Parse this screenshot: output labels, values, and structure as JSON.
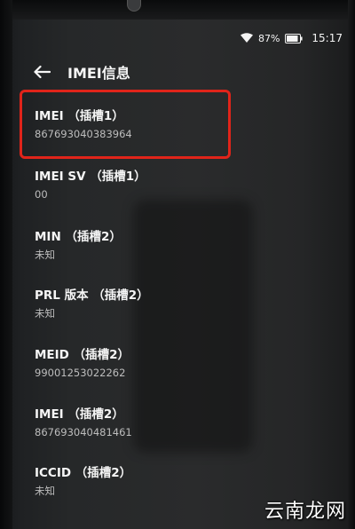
{
  "status_bar": {
    "battery_percent": "87%",
    "time": "15:17"
  },
  "app_bar": {
    "title": "IMEI信息"
  },
  "items": [
    {
      "title": "IMEI （插槽1）",
      "value": "867693040383964"
    },
    {
      "title": "IMEI SV （插槽1）",
      "value": "00"
    },
    {
      "title": "MIN （插槽2）",
      "value": "未知"
    },
    {
      "title": "PRL 版本 （插槽2）",
      "value": "未知"
    },
    {
      "title": "MEID （插槽2）",
      "value": "99001253022262"
    },
    {
      "title": "IMEI （插槽2）",
      "value": "867693040481461"
    },
    {
      "title": "ICCID （插槽2）",
      "value": "未知"
    }
  ],
  "watermark": "云南龙网",
  "colors": {
    "highlight": "#e0241a",
    "background": "#2a2b2c",
    "title_text": "#f5f5f5",
    "value_text": "#bdbdbd"
  },
  "icons": {
    "back": "back-arrow-icon",
    "wifi": "wifi-icon",
    "battery": "battery-icon"
  }
}
